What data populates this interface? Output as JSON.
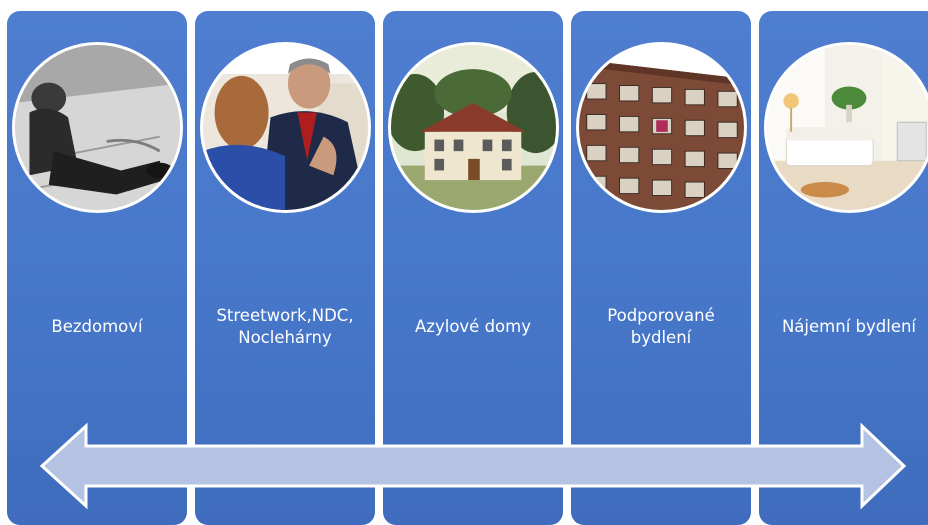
{
  "stages": [
    {
      "label": "Bezdomoví",
      "icon": "homeless-person-photo"
    },
    {
      "label": "Streetwork,NDC,\nNoclehárny",
      "icon": "social-worker-conversation-photo"
    },
    {
      "label": "Azylové domy",
      "icon": "shelter-house-painting"
    },
    {
      "label": "Podporované\nbydlení",
      "icon": "apartment-block-photo"
    },
    {
      "label": "Nájemní bydlení",
      "icon": "furnished-living-room-photo"
    }
  ],
  "colors": {
    "column": "#4676c8",
    "arrow_fill": "#b4c3e2",
    "arrow_stroke": "#ffffff",
    "text": "#ffffff"
  }
}
